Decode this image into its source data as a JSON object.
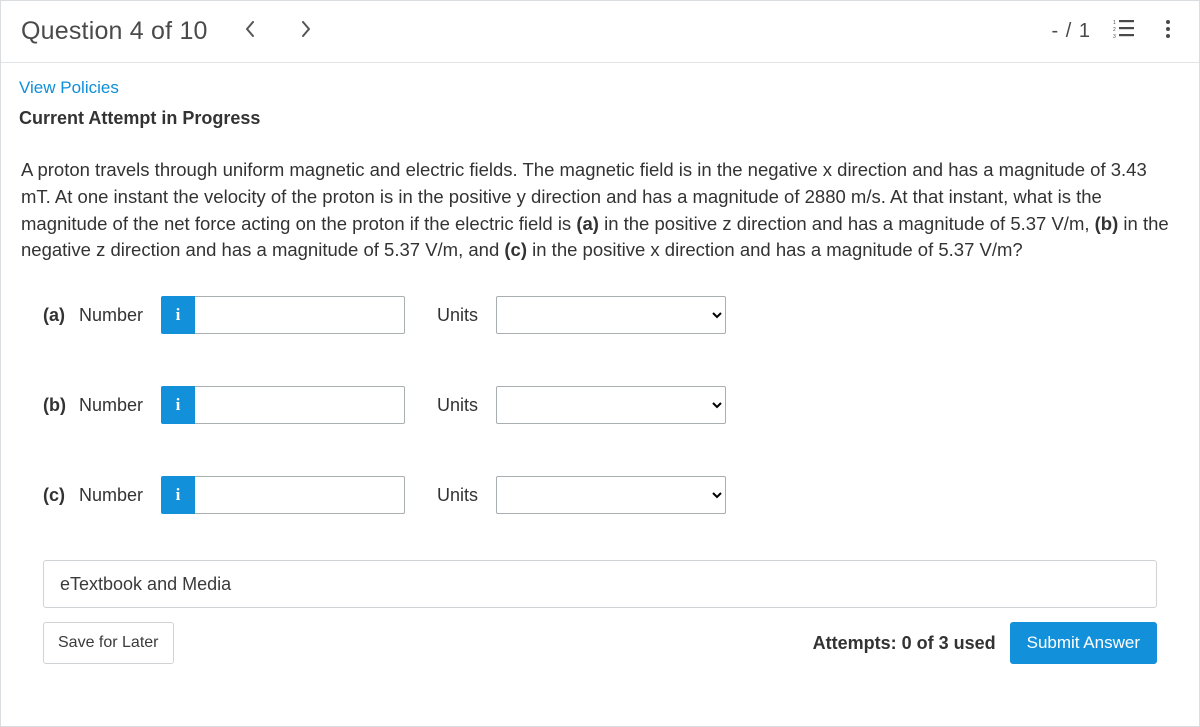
{
  "header": {
    "title": "Question 4 of 10",
    "score": "- / 1"
  },
  "links": {
    "policies": "View Policies"
  },
  "attempt_heading": "Current Attempt in Progress",
  "problem": {
    "p1": "A proton travels through uniform magnetic and electric fields. The magnetic field is in the negative x direction and has a magnitude of 3.43 mT. At one instant the velocity of the proton is in the positive y direction and has a magnitude of 2880 m/s. At that instant, what is the magnitude of the net force acting on the proton if the electric field is ",
    "a_label": "(a)",
    "a_text": " in the positive z direction and has a magnitude of 5.37 V/m, ",
    "b_label": "(b)",
    "b_text": " in the negative z direction and has a magnitude of 5.37 V/m, and ",
    "c_label": "(c)",
    "c_text": " in the positive x direction and has a magnitude of 5.37 V/m?"
  },
  "answers": {
    "number_label": "Number",
    "units_label": "Units",
    "info_glyph": "i",
    "parts": [
      {
        "id": "(a)"
      },
      {
        "id": "(b)"
      },
      {
        "id": "(c)"
      }
    ]
  },
  "resources": {
    "etextbook": "eTextbook and Media"
  },
  "footer": {
    "save": "Save for Later",
    "attempts": "Attempts: 0 of 3 used",
    "submit": "Submit Answer"
  }
}
